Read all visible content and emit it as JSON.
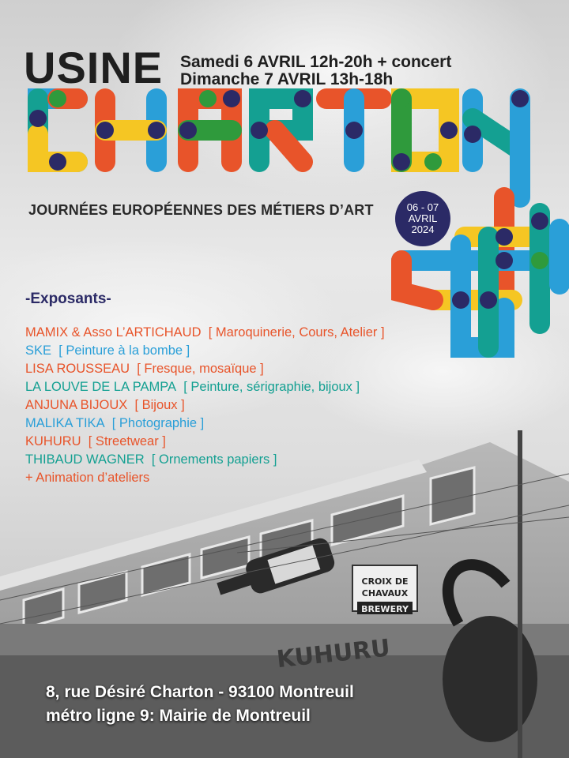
{
  "header": {
    "usine": "USINE",
    "date_line1": "Samedi 6 AVRIL 12h-20h + concert",
    "date_line2": "Dimanche 7 AVRIL 13h-18h",
    "subtitle": "JOURNÉES EUROPÉENNES DES MÉTIERS D’ART"
  },
  "logo": {
    "word": "CHARTON",
    "name": "charton-colorful-tube-logo"
  },
  "badge": {
    "line1": "06 - 07",
    "line2": "AVRIL",
    "line3": "2024"
  },
  "exposants": {
    "title": "-Exposants-",
    "items": [
      {
        "name": "MAMIX & Asso L’ARTICHAUD",
        "craft": "[ Maroquinerie, Cours, Atelier ]",
        "color": "#e8542a"
      },
      {
        "name": "SKE",
        "craft": "[ Peinture à la bombe ]",
        "color": "#2a9fd8"
      },
      {
        "name": "LISA ROUSSEAU",
        "craft": "[ Fresque, mosaïque ]",
        "color": "#e8542a"
      },
      {
        "name": "LA LOUVE DE LA PAMPA",
        "craft": "[ Peinture, sérigraphie, bijoux  ]",
        "color": "#14a092"
      },
      {
        "name": "ANJUNA BIJOUX",
        "craft": "[ Bijoux ]",
        "color": "#e8542a"
      },
      {
        "name": "MALIKA TIKA",
        "craft": "[ Photographie ]",
        "color": "#2a9fd8"
      },
      {
        "name": "KUHURU",
        "craft": "[ Streetwear ]",
        "color": "#e8542a"
      },
      {
        "name": "THIBAUD WAGNER",
        "craft": "[ Ornements papiers ]",
        "color": "#14a092"
      }
    ],
    "extra": "+ Animation d’ateliers",
    "extra_color": "#e8542a"
  },
  "address": {
    "line1": "8, rue Désiré Charton - 93100 Montreuil",
    "line2": "métro ligne 9: Mairie de Montreuil"
  },
  "photo": {
    "description_name": "factory-building-photo",
    "sign_text": "CROIX DE CHAVAUX",
    "sign_sub": "BREWERY",
    "graffiti": "KUHURU"
  },
  "colors": {
    "orange": "#e8542a",
    "blue": "#2a9fd8",
    "yellow": "#f5c623",
    "green": "#2f9a3c",
    "teal": "#14a092",
    "navy": "#2b2a66"
  }
}
